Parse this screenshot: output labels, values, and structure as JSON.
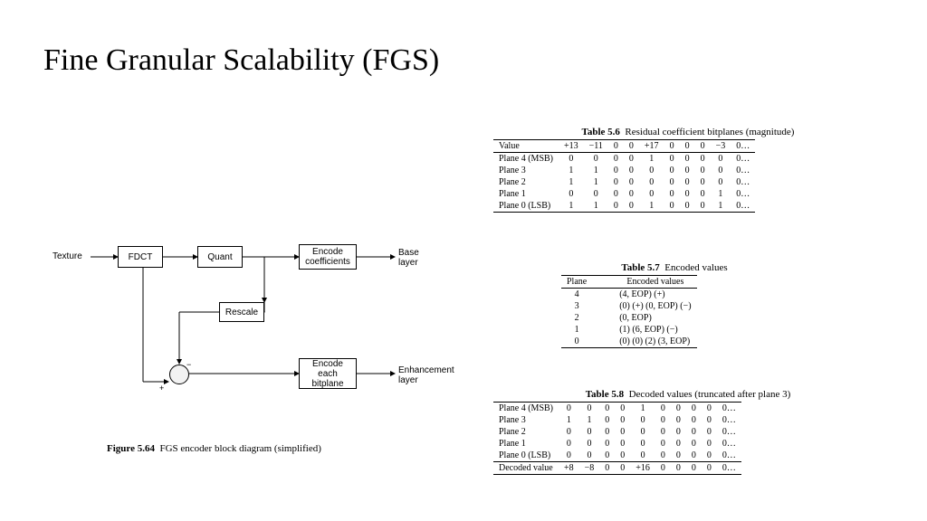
{
  "title": "Fine Granular Scalability (FGS)",
  "diagram": {
    "texture": "Texture",
    "fdct": "FDCT",
    "quant": "Quant",
    "encode_coeff": "Encode\ncoefficients",
    "base_layer": "Base\nlayer",
    "rescale": "Rescale",
    "encode_bitplane": "Encode\neach\nbitplane",
    "enh_layer": "Enhancement\nlayer",
    "plus": "+",
    "minus": "−",
    "caption_label": "Figure 5.64",
    "caption_text": "FGS encoder block diagram (simplified)"
  },
  "table56": {
    "caption_label": "Table 5.6",
    "caption_text": "Residual coefficient bitplanes (magnitude)",
    "head": [
      "Value",
      "+13",
      "−11",
      "0",
      "0",
      "+17",
      "0",
      "0",
      "0",
      "−3",
      "0…"
    ],
    "rows": [
      [
        "Plane 4 (MSB)",
        "0",
        "0",
        "0",
        "0",
        "1",
        "0",
        "0",
        "0",
        "0",
        "0…"
      ],
      [
        "Plane 3",
        "1",
        "1",
        "0",
        "0",
        "0",
        "0",
        "0",
        "0",
        "0",
        "0…"
      ],
      [
        "Plane 2",
        "1",
        "1",
        "0",
        "0",
        "0",
        "0",
        "0",
        "0",
        "0",
        "0…"
      ],
      [
        "Plane 1",
        "0",
        "0",
        "0",
        "0",
        "0",
        "0",
        "0",
        "0",
        "1",
        "0…"
      ],
      [
        "Plane 0 (LSB)",
        "1",
        "1",
        "0",
        "0",
        "1",
        "0",
        "0",
        "0",
        "1",
        "0…"
      ]
    ]
  },
  "table57": {
    "caption_label": "Table 5.7",
    "caption_text": "Encoded values",
    "head": [
      "Plane",
      "Encoded values"
    ],
    "rows": [
      [
        "4",
        "(4, EOP) (+)"
      ],
      [
        "3",
        "(0) (+) (0, EOP) (−)"
      ],
      [
        "2",
        "(0, EOP)"
      ],
      [
        "1",
        "(1) (6, EOP) (−)"
      ],
      [
        "0",
        "(0) (0) (2) (3, EOP)"
      ]
    ]
  },
  "table58": {
    "caption_label": "Table 5.8",
    "caption_text": "Decoded values (truncated after plane 3)",
    "rows": [
      [
        "Plane 4 (MSB)",
        "0",
        "0",
        "0",
        "0",
        "1",
        "0",
        "0",
        "0",
        "0",
        "0…"
      ],
      [
        "Plane 3",
        "1",
        "1",
        "0",
        "0",
        "0",
        "0",
        "0",
        "0",
        "0",
        "0…"
      ],
      [
        "Plane 2",
        "0",
        "0",
        "0",
        "0",
        "0",
        "0",
        "0",
        "0",
        "0",
        "0…"
      ],
      [
        "Plane 1",
        "0",
        "0",
        "0",
        "0",
        "0",
        "0",
        "0",
        "0",
        "0",
        "0…"
      ],
      [
        "Plane 0 (LSB)",
        "0",
        "0",
        "0",
        "0",
        "0",
        "0",
        "0",
        "0",
        "0",
        "0…"
      ],
      [
        "Decoded value",
        "+8",
        "−8",
        "0",
        "0",
        "+16",
        "0",
        "0",
        "0",
        "0",
        "0…"
      ]
    ]
  }
}
